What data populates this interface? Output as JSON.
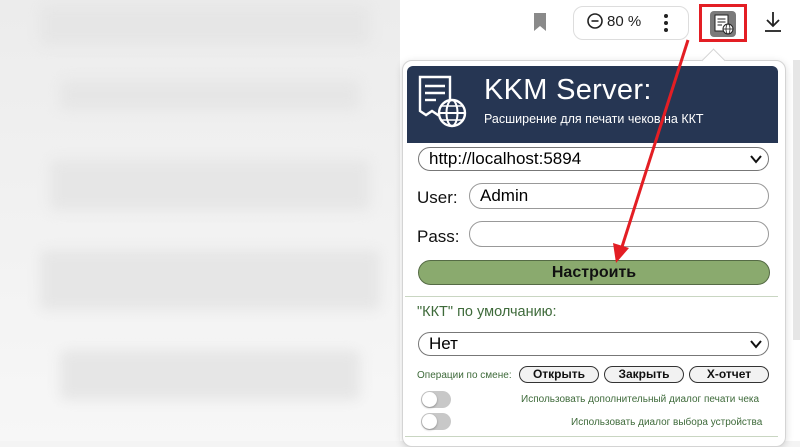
{
  "browser": {
    "zoom": "80 %",
    "icons": [
      "bookmark-icon",
      "zoom-out-icon",
      "menu-dots-icon",
      "extension-icon",
      "download-icon"
    ]
  },
  "popup": {
    "title": "KKM Server:",
    "subtitle": "Расширение для печати чеков на ККТ",
    "server_url": "http://localhost:5894",
    "user_label": "User:",
    "user_value": "Admin",
    "pass_label": "Pass:",
    "pass_value": "",
    "setup_button": "Настроить",
    "kkt_default_label": "\"ККТ\" по умолчанию:",
    "kkt_default_value": "Нет",
    "shift_ops_label": "Операции по смене:",
    "ops": {
      "open": "Открыть",
      "close": "Закрыть",
      "x_report": "Х-отчет"
    },
    "toggle1_label": "Использовать дополнительный диалог печати чека",
    "toggle2_label": "Использовать диалог выбора устройства"
  },
  "colors": {
    "header_bg": "#263653",
    "setup_button_bg": "#8aaa6e",
    "highlight_red": "#e31e24",
    "green_text": "#3e6a3a"
  }
}
